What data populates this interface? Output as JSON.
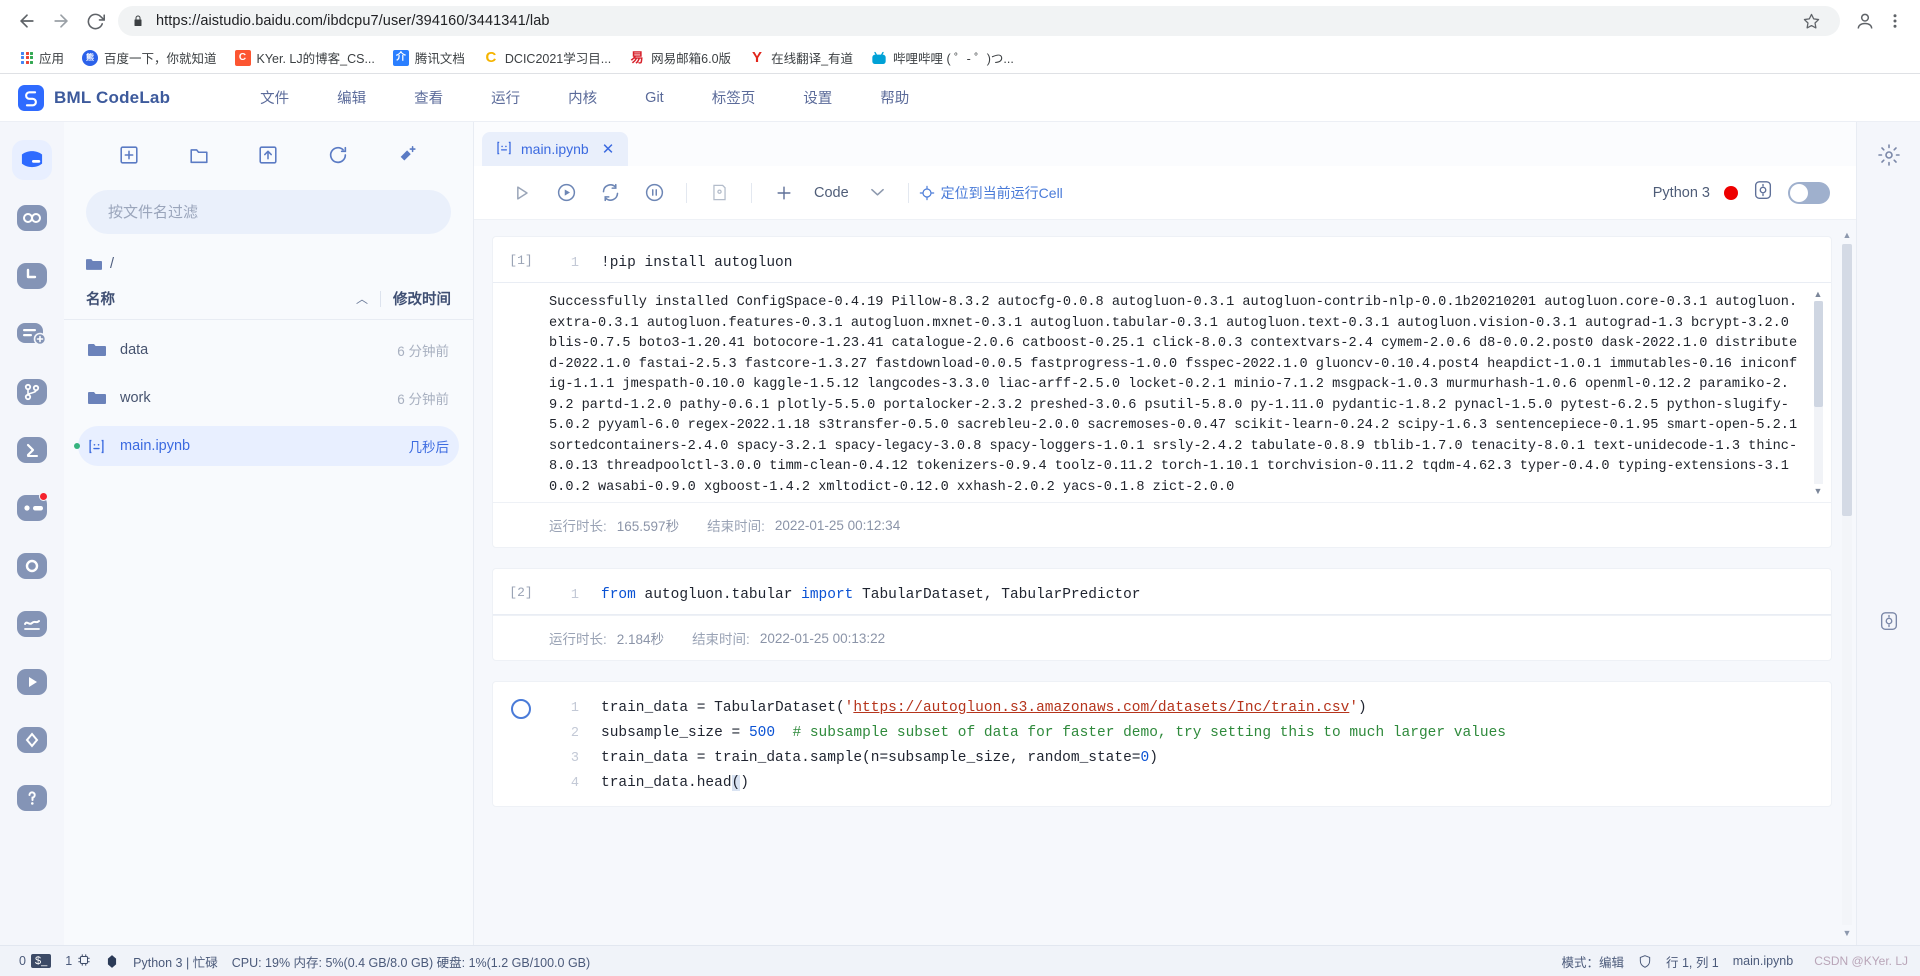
{
  "browser": {
    "back_label": "back-arrow",
    "forward_label": "forward-arrow",
    "reload_label": "reload",
    "url": "https://aistudio.baidu.com/ibdcpu7/user/394160/3441341/lab",
    "bookmarks": [
      {
        "label": "应用",
        "icon": "apps-grid-icon",
        "color": "#4285f4",
        "letter": ""
      },
      {
        "label": "百度一下，你就知道",
        "icon": "baidu-icon",
        "color": "#2c62ea",
        "letter": "熊"
      },
      {
        "label": "KYer. LJ的博客_CS...",
        "icon": "csdn-icon",
        "color": "#fc5531",
        "letter": "C"
      },
      {
        "label": "腾讯文档",
        "icon": "tencent-docs-icon",
        "color": "#2b7fff",
        "letter": "介"
      },
      {
        "label": "DCIC2021学习目...",
        "icon": "dcic-icon",
        "color": "#f5b400",
        "letter": "C"
      },
      {
        "label": "网易邮箱6.0版",
        "icon": "netease-mail-icon",
        "color": "#d7202a",
        "letter": "易"
      },
      {
        "label": "在线翻译_有道",
        "icon": "youdao-icon",
        "color": "#e1251b",
        "letter": "Y"
      },
      {
        "label": "哔哩哔哩 ( ゜- ゜)つ...",
        "icon": "bilibili-icon",
        "color": "#00a1d6",
        "letter": "bi"
      }
    ]
  },
  "bml": {
    "brand": "BML CodeLab",
    "logo_icon": "bml-logo-icon",
    "menu": [
      "文件",
      "编辑",
      "查看",
      "运行",
      "内核",
      "Git",
      "标签页",
      "设置",
      "帮助"
    ]
  },
  "left_rail": {
    "items": [
      {
        "name": "notebook-icon",
        "active": true,
        "badge": false
      },
      {
        "name": "link-chain-icon",
        "active": false,
        "badge": false
      },
      {
        "name": "clock-icon",
        "active": false,
        "badge": false
      },
      {
        "name": "add-note-icon",
        "active": false,
        "badge": false
      },
      {
        "name": "git-branch-icon",
        "active": false,
        "badge": false
      },
      {
        "name": "terminal-icon",
        "active": false,
        "badge": false
      },
      {
        "name": "extension-icon",
        "active": false,
        "badge": true
      },
      {
        "name": "circle-icon",
        "active": false,
        "badge": false
      },
      {
        "name": "chart-line-icon",
        "active": false,
        "badge": false
      },
      {
        "name": "play-icon",
        "active": false,
        "badge": false
      },
      {
        "name": "diamond-icon",
        "active": false,
        "badge": false
      },
      {
        "name": "help-icon",
        "active": false,
        "badge": false
      }
    ]
  },
  "filepanel": {
    "toolbar": [
      {
        "name": "new-file-icon"
      },
      {
        "name": "new-folder-icon"
      },
      {
        "name": "upload-icon"
      },
      {
        "name": "refresh-icon"
      },
      {
        "name": "new-launcher-icon"
      }
    ],
    "search": {
      "placeholder": "按文件名过滤",
      "value": ""
    },
    "breadcrumb": "/",
    "columns": {
      "name": "名称",
      "modified": "修改时间"
    },
    "rows": [
      {
        "name": "data",
        "time": "6 分钟前",
        "type": "folder",
        "selected": false,
        "running": false
      },
      {
        "name": "work",
        "time": "6 分钟前",
        "type": "folder",
        "selected": false,
        "running": false
      },
      {
        "name": "main.ipynb",
        "time": "几秒后",
        "type": "notebook",
        "selected": true,
        "running": true
      }
    ]
  },
  "notebook": {
    "tab": {
      "label": "main.ipynb",
      "icon": "notebook-file-icon",
      "close": "✕"
    },
    "toolbar": {
      "run_icon": "run-icon",
      "run_all_icon": "run-all-icon",
      "restart_icon": "restart-kernel-icon",
      "interrupt_icon": "interrupt-icon",
      "save_icon": "save-icon",
      "add_icon": "add-cell-icon",
      "cell_type": "Code",
      "caret": "⌄",
      "locate_label": "定位到当前运行Cell",
      "kernel_name": "Python 3",
      "kernel_status_color": "#ee0000",
      "kernel_icon": "kernel-busy-icon",
      "toggle_on": false
    },
    "cells": [
      {
        "prompt": "[1]",
        "state": "done",
        "lines": [
          {
            "no": "1",
            "segments": [
              {
                "t": "!pip install autogluon",
                "c": "plain"
              }
            ]
          }
        ],
        "output": "Successfully installed ConfigSpace-0.4.19 Pillow-8.3.2 autocfg-0.0.8 autogluon-0.3.1 autogluon-contrib-nlp-0.0.1b20210201 autogluon.core-0.3.1 autogluon.extra-0.3.1 autogluon.features-0.3.1 autogluon.mxnet-0.3.1 autogluon.tabular-0.3.1 autogluon.text-0.3.1 autogluon.vision-0.3.1 autograd-1.3 bcrypt-3.2.0 blis-0.7.5 boto3-1.20.41 botocore-1.23.41 catalogue-2.0.6 catboost-0.25.1 click-8.0.3 contextvars-2.4 cymem-2.0.6 d8-0.0.2.post0 dask-2022.1.0 distributed-2022.1.0 fastai-2.5.3 fastcore-1.3.27 fastdownload-0.0.5 fastprogress-1.0.0 fsspec-2022.1.0 gluoncv-0.10.4.post4 heapdict-1.0.1 immutables-0.16 iniconfig-1.1.1 jmespath-0.10.0 kaggle-1.5.12 langcodes-3.3.0 liac-arff-2.5.0 locket-0.2.1 minio-7.1.2 msgpack-1.0.3 murmurhash-1.0.6 openml-0.12.2 paramiko-2.9.2 partd-1.2.0 pathy-0.6.1 plotly-5.5.0 portalocker-2.3.2 preshed-3.0.6 psutil-5.8.0 py-1.11.0 pydantic-1.8.2 pynacl-1.5.0 pytest-6.2.5 python-slugify-5.0.2 pyyaml-6.0 regex-2022.1.18 s3transfer-0.5.0 sacrebleu-2.0.0 sacremoses-0.0.47 scikit-learn-0.24.2 scipy-1.6.3 sentencepiece-0.1.95 smart-open-5.2.1 sortedcontainers-2.4.0 spacy-3.2.1 spacy-legacy-3.0.8 spacy-loggers-1.0.1 srsly-2.4.2 tabulate-0.8.9 tblib-1.7.0 tenacity-8.0.1 text-unidecode-1.3 thinc-8.0.13 threadpoolctl-3.0.0 timm-clean-0.4.12 tokenizers-0.9.4 toolz-0.11.2 torch-1.10.1 torchvision-0.11.2 tqdm-4.62.3 typer-0.4.0 typing-extensions-3.10.0.2 wasabi-0.9.0 xgboost-1.4.2 xmltodict-0.12.0 xxhash-2.0.2 yacs-0.1.8 zict-2.0.0",
        "meta": {
          "duration_label": "运行时长:",
          "duration": "165.597秒",
          "end_label": "结束时间:",
          "end": "2022-01-25 00:12:34"
        }
      },
      {
        "prompt": "[2]",
        "state": "done",
        "lines": [
          {
            "no": "1",
            "segments": [
              {
                "t": "from",
                "c": "kw"
              },
              {
                "t": " autogluon.tabular ",
                "c": "plain"
              },
              {
                "t": "import",
                "c": "kw"
              },
              {
                "t": " TabularDataset, TabularPredictor",
                "c": "plain"
              }
            ]
          }
        ],
        "output": "",
        "meta": {
          "duration_label": "运行时长:",
          "duration": "2.184秒",
          "end_label": "结束时间:",
          "end": "2022-01-25 00:13:22"
        }
      },
      {
        "prompt": "",
        "state": "running",
        "lines": [
          {
            "no": "1",
            "segments": [
              {
                "t": "train_data = TabularDataset(",
                "c": "plain"
              },
              {
                "t": "'",
                "c": "str"
              },
              {
                "t": "https://autogluon.s3.amazonaws.com/datasets/Inc/train.csv",
                "c": "link"
              },
              {
                "t": "'",
                "c": "str"
              },
              {
                "t": ")",
                "c": "plain"
              }
            ]
          },
          {
            "no": "2",
            "segments": [
              {
                "t": "subsample_size = ",
                "c": "plain"
              },
              {
                "t": "500",
                "c": "num"
              },
              {
                "t": "  ",
                "c": "plain"
              },
              {
                "t": "# subsample subset of data for faster demo, try setting this to much larger values",
                "c": "com"
              }
            ]
          },
          {
            "no": "3",
            "segments": [
              {
                "t": "train_data = train_data.sample(n=subsample_size, random_state=",
                "c": "plain"
              },
              {
                "t": "0",
                "c": "num"
              },
              {
                "t": ")",
                "c": "plain"
              }
            ]
          },
          {
            "no": "4",
            "segments": [
              {
                "t": "train_data.head",
                "c": "plain"
              },
              {
                "t": "(",
                "c": "sel"
              },
              {
                "t": ")",
                "c": "plain"
              }
            ]
          }
        ],
        "output": "",
        "meta": null
      }
    ]
  },
  "right_rail": {
    "items": [
      {
        "name": "settings-gear-icon"
      },
      {
        "name": "kernel-panel-icon"
      }
    ]
  },
  "statusbar": {
    "terminal_count": "0",
    "terminal_icon": "terminal-icon",
    "kernel_count": "1",
    "kernel_icon": "kernel-icon",
    "gpu_icon": "gpu-icon",
    "kernel_label": "Python 3 | 忙碌",
    "resources": "CPU: 19% 内存: 5%(0.4 GB/8.0 GB) 硬盘: 1%(1.2 GB/100.0 GB)",
    "mode_label": "模式：编辑",
    "shield_icon": "shield-icon",
    "position": "行 1, 列 1",
    "filename": "main.ipynb",
    "watermark": "CSDN @KYer. LJ"
  }
}
